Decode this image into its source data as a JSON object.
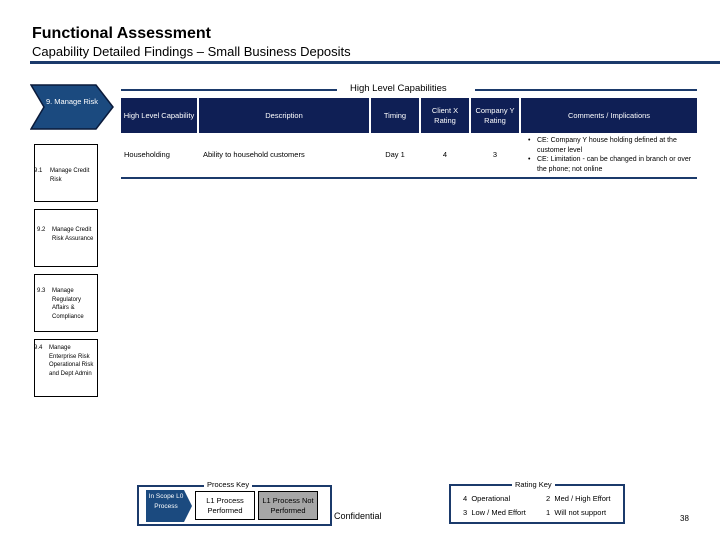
{
  "header": {
    "title": "Functional Assessment",
    "subtitle": "Capability Detailed Findings – Small Business Deposits"
  },
  "process": {
    "chevron_label": "9. Manage Risk",
    "sub_processes": [
      {
        "number": "9.1",
        "name": "Manage Credit Risk"
      },
      {
        "number": "9.2",
        "name": "Manage Credit Risk Assurance"
      },
      {
        "number": "9.3",
        "name": "Manage Regulatory Affairs & Compliance"
      },
      {
        "number": "9.4",
        "name": "Manage Enterprise Risk Operational Risk and Dept Admin"
      }
    ]
  },
  "section_title": "High Level Capabilities",
  "table": {
    "columns": [
      "High Level Capability",
      "Description",
      "Timing",
      "Client X Rating",
      "Company Y Rating",
      "Comments / Implications"
    ],
    "rows": [
      {
        "capability": "Householding",
        "description": "Ability to household customers",
        "timing": "Day 1",
        "client_x_rating": "4",
        "company_y_rating": "3",
        "comments": [
          "CE: Company Y house holding defined at the customer level",
          "CE: Limitation - can be changed in branch or over the phone; not online"
        ]
      }
    ]
  },
  "process_key": {
    "title": "Process Key",
    "in_scope": "In Scope L0 Process",
    "performed": "L1 Process Performed",
    "not_performed": "L1 Process Not Performed"
  },
  "rating_key": {
    "title": "Rating Key",
    "items": [
      {
        "value": "4",
        "label": "Operational"
      },
      {
        "value": "2",
        "label": "Med / High Effort"
      },
      {
        "value": "3",
        "label": "Low / Med Effort"
      },
      {
        "value": "1",
        "label": "Will not support"
      }
    ]
  },
  "footer": {
    "confidential": "Confidential",
    "page_number": "38"
  },
  "colors": {
    "navy": "#0f1f55",
    "chevron": "#1b4a7f",
    "rule": "#1b3a6b",
    "not_performed_gray": "#a6a6a6"
  }
}
